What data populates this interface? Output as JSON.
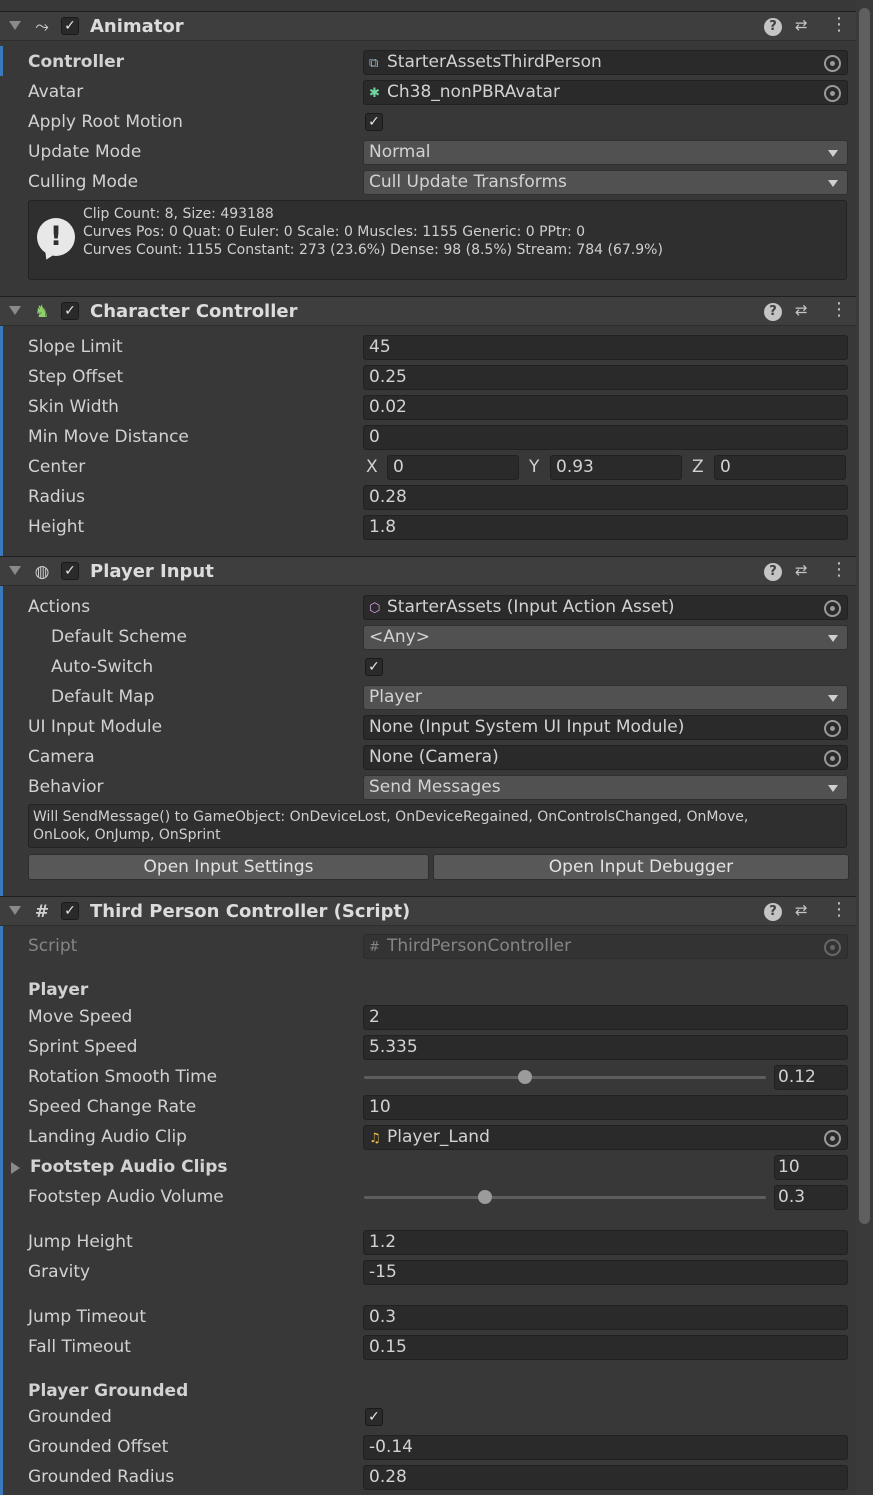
{
  "animator": {
    "title": "Animator",
    "controller": {
      "label": "Controller",
      "value": "StarterAssetsThirdPerson"
    },
    "avatar": {
      "label": "Avatar",
      "value": "Ch38_nonPBRAvatar"
    },
    "apply_root_motion": {
      "label": "Apply Root Motion",
      "checked": true
    },
    "update_mode": {
      "label": "Update Mode",
      "value": "Normal"
    },
    "culling_mode": {
      "label": "Culling Mode",
      "value": "Cull Update Transforms"
    },
    "info": {
      "line1": "Clip Count: 8, Size: 493188",
      "line2": "Curves Pos: 0 Quat: 0 Euler: 0 Scale: 0 Muscles: 1155 Generic: 0 PPtr: 0",
      "line3": "Curves Count: 1155 Constant: 273 (23.6%) Dense: 98 (8.5%) Stream: 784 (67.9%)"
    }
  },
  "character_controller": {
    "title": "Character Controller",
    "slope_limit": {
      "label": "Slope Limit",
      "value": "45"
    },
    "step_offset": {
      "label": "Step Offset",
      "value": "0.25"
    },
    "skin_width": {
      "label": "Skin Width",
      "value": "0.02"
    },
    "min_move_distance": {
      "label": "Min Move Distance",
      "value": "0"
    },
    "center": {
      "label": "Center",
      "x_label": "X",
      "x": "0",
      "y_label": "Y",
      "y": "0.93",
      "z_label": "Z",
      "z": "0"
    },
    "radius": {
      "label": "Radius",
      "value": "0.28"
    },
    "height": {
      "label": "Height",
      "value": "1.8"
    }
  },
  "player_input": {
    "title": "Player Input",
    "actions": {
      "label": "Actions",
      "value": "StarterAssets (Input Action Asset)"
    },
    "default_scheme": {
      "label": "Default Scheme",
      "value": "<Any>"
    },
    "auto_switch": {
      "label": "Auto-Switch",
      "checked": true
    },
    "default_map": {
      "label": "Default Map",
      "value": "Player"
    },
    "ui_input_module": {
      "label": "UI Input Module",
      "value": "None (Input System UI Input Module)"
    },
    "camera": {
      "label": "Camera",
      "value": "None (Camera)"
    },
    "behavior": {
      "label": "Behavior",
      "value": "Send Messages"
    },
    "info": {
      "line1": "Will SendMessage() to GameObject: OnDeviceLost, OnDeviceRegained, OnControlsChanged, OnMove,",
      "line2": "OnLook, OnJump, OnSprint"
    },
    "open_settings_label": "Open Input Settings",
    "open_debugger_label": "Open Input Debugger"
  },
  "third_person_controller": {
    "title": "Third Person Controller (Script)",
    "script": {
      "label": "Script",
      "value": "ThirdPersonController"
    },
    "section_player": "Player",
    "move_speed": {
      "label": "Move Speed",
      "value": "2"
    },
    "sprint_speed": {
      "label": "Sprint Speed",
      "value": "5.335"
    },
    "rotation_smooth_time": {
      "label": "Rotation Smooth Time",
      "value": "0.12",
      "fraction": 0.4
    },
    "speed_change_rate": {
      "label": "Speed Change Rate",
      "value": "10"
    },
    "landing_audio_clip": {
      "label": "Landing Audio Clip",
      "value": "Player_Land"
    },
    "footstep_audio_clips": {
      "label": "Footstep Audio Clips",
      "size": "10"
    },
    "footstep_audio_volume": {
      "label": "Footstep Audio Volume",
      "value": "0.3",
      "fraction": 0.3
    },
    "jump_height": {
      "label": "Jump Height",
      "value": "1.2"
    },
    "gravity": {
      "label": "Gravity",
      "value": "-15"
    },
    "jump_timeout": {
      "label": "Jump Timeout",
      "value": "0.3"
    },
    "fall_timeout": {
      "label": "Fall Timeout",
      "value": "0.15"
    },
    "section_grounded": "Player Grounded",
    "grounded": {
      "label": "Grounded",
      "checked": true
    },
    "grounded_offset": {
      "label": "Grounded Offset",
      "value": "-0.14"
    },
    "grounded_radius": {
      "label": "Grounded Radius",
      "value": "0.28"
    }
  },
  "icons": {
    "animator": "animator-icon",
    "character_controller": "character-controller-icon",
    "player_input": "player-input-icon",
    "script": "script-icon"
  },
  "colors": {
    "accent_bar": "#3a79bb",
    "background": "#383838"
  }
}
